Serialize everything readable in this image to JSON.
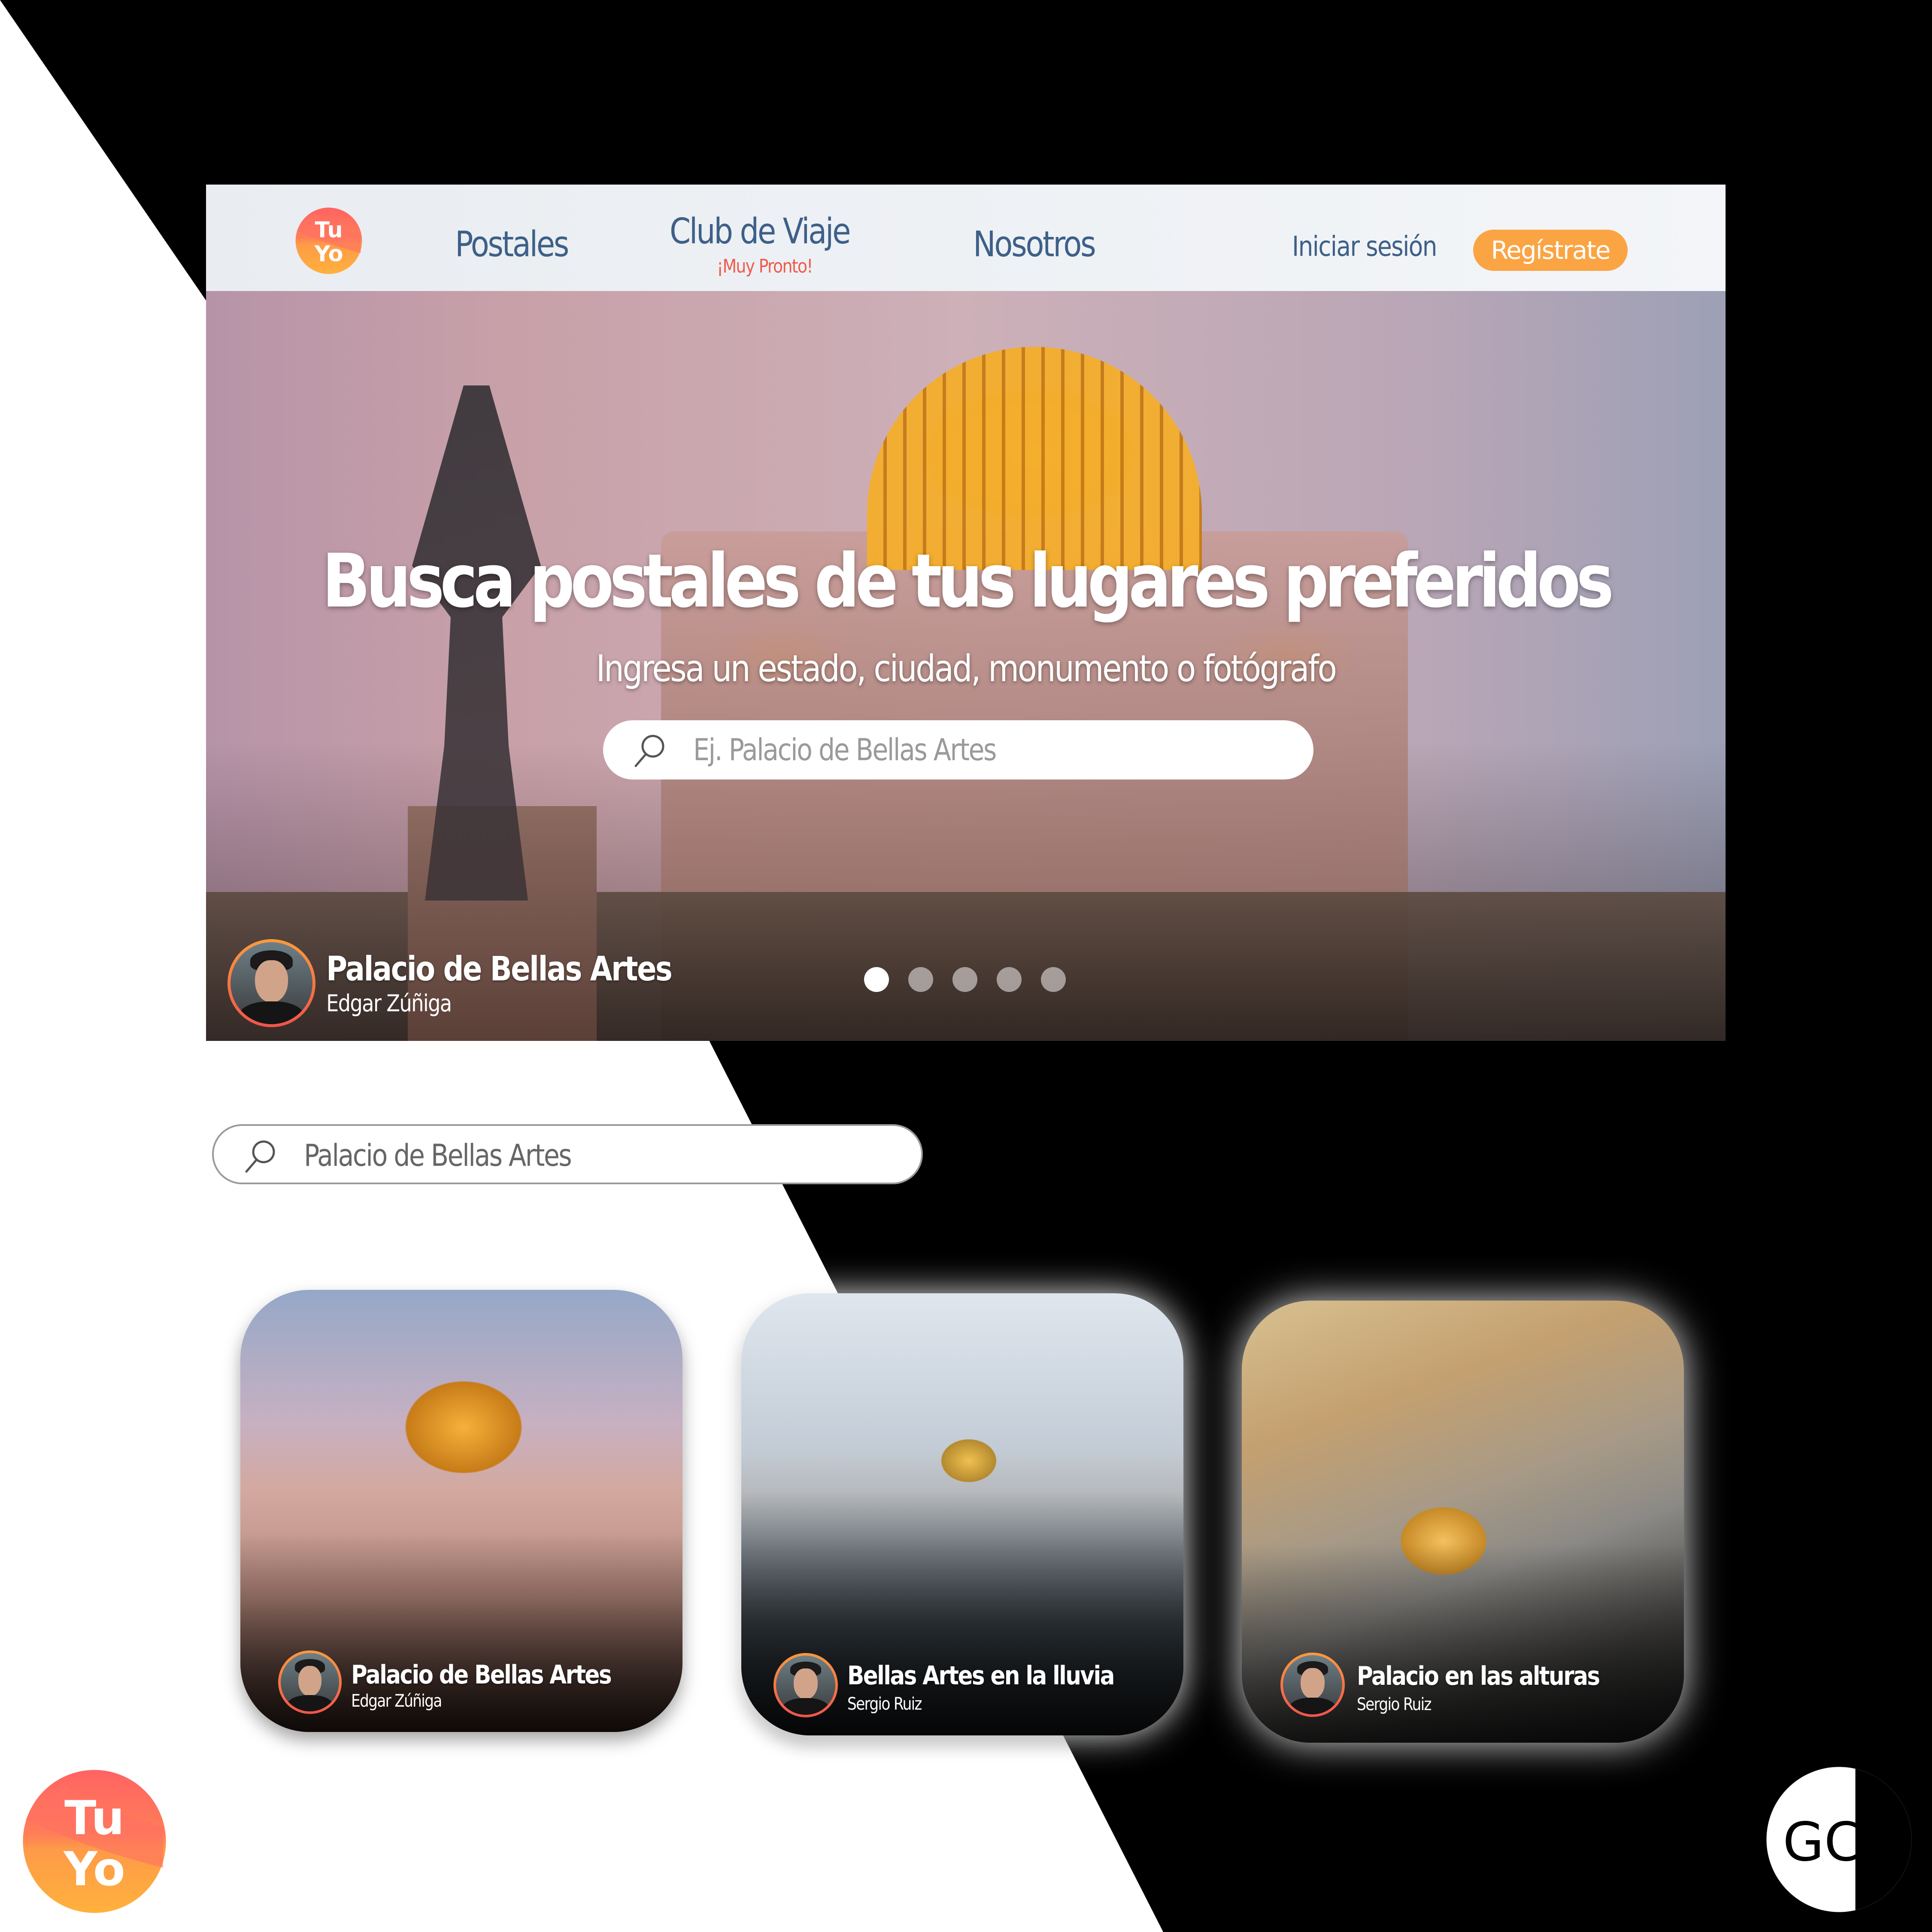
{
  "brand": {
    "logo_line1": "Tu",
    "logo_line2": "Yo",
    "colors": {
      "logo_top": "#ff6363",
      "logo_bottom": "#ffb13d",
      "nav_text": "#3d6088",
      "accent_orange": "#fba444",
      "soon_red": "#f05a4a"
    }
  },
  "navbar": {
    "items": [
      {
        "label": "Postales"
      },
      {
        "label": "Club de Viaje",
        "badge": "¡Muy Pronto!"
      },
      {
        "label": "Nosotros"
      }
    ],
    "login_label": "Iniciar sesión",
    "register_label": "Regístrate"
  },
  "hero": {
    "title": "Busca postales de tus lugares preferidos",
    "subtitle": "Ingresa un estado, ciudad, monumento o fotógrafo",
    "search": {
      "icon": "search-icon",
      "placeholder": "Ej. Palacio de Bellas Artes",
      "value": ""
    },
    "credit": {
      "title": "Palacio de Bellas Artes",
      "author": "Edgar Zúñiga"
    },
    "carousel": {
      "count": 5,
      "active_index": 0
    }
  },
  "results_search": {
    "icon": "search-icon",
    "value": "Palacio de Bellas Artes"
  },
  "results": [
    {
      "title": "Palacio de Bellas Artes",
      "author": "Edgar Zúñiga"
    },
    {
      "title": "Bellas Artes en la lluvia",
      "author": "Sergio Ruiz"
    },
    {
      "title": "Palacio en las alturas",
      "author": "Sergio Ruiz"
    }
  ],
  "watermark": {
    "text": "GCP"
  }
}
